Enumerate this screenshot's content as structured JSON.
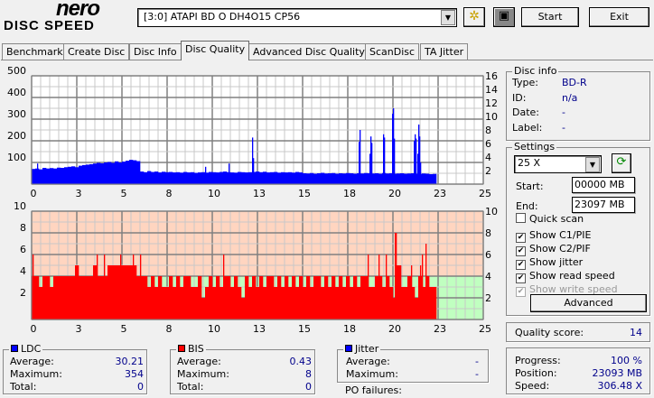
{
  "app": {
    "logo_top": "nero",
    "logo_bottom": "DISC SPEED"
  },
  "toolbar": {
    "drive": "[3:0]  ATAPI BD  O  DH4O15 CP56",
    "start_label": "Start",
    "exit_label": "Exit",
    "drive_icon": "drive-settings-icon",
    "save_icon": "floppy-disk-icon"
  },
  "tabs": [
    {
      "label": "Benchmark"
    },
    {
      "label": "Create Disc"
    },
    {
      "label": "Disc Info"
    },
    {
      "label": "Disc Quality",
      "selected": true
    },
    {
      "label": "Advanced Disc Quality"
    },
    {
      "label": "ScanDisc"
    },
    {
      "label": "TA Jitter"
    }
  ],
  "disc_info": {
    "title": "Disc info",
    "type_label": "Type:",
    "type": "BD-R",
    "id_label": "ID:",
    "id": "n/a",
    "date_label": "Date:",
    "date": "-",
    "label_label": "Label:",
    "label": "-"
  },
  "settings": {
    "title": "Settings",
    "speed": "25 X",
    "start_label": "Start:",
    "start": "00000 MB",
    "end_label": "End:",
    "end": "23097 MB",
    "checks": [
      {
        "label": "Quick scan",
        "checked": false,
        "enabled": true
      },
      {
        "label": "Show C1/PIE",
        "checked": true,
        "enabled": true
      },
      {
        "label": "Show C2/PIF",
        "checked": true,
        "enabled": true
      },
      {
        "label": "Show jitter",
        "checked": true,
        "enabled": true
      },
      {
        "label": "Show read speed",
        "checked": true,
        "enabled": true
      },
      {
        "label": "Show write speed",
        "checked": true,
        "enabled": false
      }
    ],
    "advanced_label": "Advanced"
  },
  "quality": {
    "label": "Quality score:",
    "value": "14"
  },
  "progress": {
    "progress_label": "Progress:",
    "progress": "100 %",
    "position_label": "Position:",
    "position": "23093 MB",
    "speed_label": "Speed:",
    "speed": "306.48 X"
  },
  "ldc": {
    "title": "LDC",
    "color": "#0000ff",
    "avg_label": "Average:",
    "avg": "30.21",
    "max_label": "Maximum:",
    "max": "354",
    "total_label": "Total:",
    "total": "0"
  },
  "bis": {
    "title": "BIS",
    "color": "#ff0000",
    "avg_label": "Average:",
    "avg": "0.43",
    "max_label": "Maximum:",
    "max": "8",
    "total_label": "Total:",
    "total": "0"
  },
  "jitter": {
    "title": "Jitter",
    "color": "#0000ff",
    "avg_label": "Average:",
    "avg": "-",
    "max_label": "Maximum:",
    "max": "-",
    "po_label": "PO failures:"
  },
  "chart_data": [
    {
      "type": "bar",
      "name": "LDC",
      "color": "#0000ff",
      "xlim": [
        0,
        25
      ],
      "ylim_left": [
        0,
        500
      ],
      "ylim_right": [
        0,
        16
      ],
      "x_ticks": [
        "0",
        "3",
        "5",
        "8",
        "10",
        "13",
        "15",
        "18",
        "20",
        "23",
        "25"
      ],
      "y_ticks_left": [
        "500",
        "400",
        "300",
        "200",
        "100"
      ],
      "y_ticks_right": [
        "16",
        "14",
        "12",
        "10",
        "8",
        "6",
        "4",
        "2"
      ],
      "step": 0.2,
      "values": [
        70,
        72,
        68,
        75,
        72,
        74,
        72,
        76,
        75,
        78,
        80,
        82,
        78,
        85,
        88,
        90,
        92,
        95,
        98,
        96,
        100,
        102,
        98,
        105,
        100,
        104,
        108,
        112,
        110,
        106,
        58,
        55,
        60,
        56,
        58,
        54,
        57,
        55,
        56,
        54,
        55,
        53,
        56,
        54,
        55,
        52,
        54,
        55,
        53,
        56,
        55,
        54,
        56,
        58,
        55,
        54,
        53,
        56,
        55,
        54,
        55,
        56,
        58,
        55,
        57,
        54,
        55,
        56,
        53,
        55,
        54,
        55,
        53,
        56,
        54,
        50,
        49,
        51,
        48,
        50,
        52,
        49,
        50,
        51,
        48,
        50,
        49,
        51,
        50,
        48,
        50,
        49,
        51,
        50,
        49,
        50,
        48,
        51,
        49,
        50,
        48,
        49,
        50,
        48,
        49,
        50,
        48,
        47,
        49,
        48,
        46,
        47
      ],
      "spikes": [
        [
          0.3,
          95
        ],
        [
          9.6,
          80
        ],
        [
          10.9,
          95
        ],
        [
          12.2,
          215
        ],
        [
          12.25,
          120
        ],
        [
          18.1,
          195
        ],
        [
          18.15,
          250
        ],
        [
          18.7,
          140
        ],
        [
          18.75,
          220
        ],
        [
          18.8,
          190
        ],
        [
          19.45,
          230
        ],
        [
          19.5,
          215
        ],
        [
          19.95,
          325
        ],
        [
          20.0,
          350
        ],
        [
          20.05,
          210
        ],
        [
          21.15,
          200
        ],
        [
          21.2,
          230
        ],
        [
          21.25,
          210
        ],
        [
          21.35,
          140
        ],
        [
          21.4,
          275
        ],
        [
          21.45,
          220
        ],
        [
          21.5,
          100
        ]
      ]
    },
    {
      "type": "bar",
      "name": "BIS",
      "color": "#ff0000",
      "xlim": [
        0,
        25
      ],
      "ylim": [
        0,
        10
      ],
      "threshold": 4,
      "bg_above": "#ffd5c0",
      "bg_below": "#c0ffc0",
      "x_ticks": [
        "0",
        "3",
        "5",
        "8",
        "10",
        "13",
        "15",
        "18",
        "20",
        "23",
        "25"
      ],
      "y_ticks": [
        "10",
        "8",
        "6",
        "4",
        "2"
      ],
      "step": 0.2,
      "values": [
        4,
        4,
        3,
        4,
        4,
        3,
        4,
        4,
        4,
        4,
        4,
        4,
        5,
        4,
        4,
        4,
        4,
        5,
        4,
        4,
        4,
        5,
        5,
        5,
        5,
        5,
        5,
        5,
        5,
        4,
        4,
        4,
        3,
        4,
        3,
        4,
        3,
        3,
        4,
        3,
        4,
        3,
        4,
        4,
        3,
        3,
        4,
        2,
        3,
        4,
        3,
        4,
        3,
        4,
        4,
        3,
        4,
        3,
        2,
        4,
        3,
        4,
        3,
        4,
        3,
        4,
        4,
        3,
        4,
        3,
        4,
        3,
        4,
        3,
        4,
        3,
        4,
        3,
        4,
        4,
        3,
        4,
        3,
        4,
        3,
        4,
        3,
        4,
        3,
        4,
        3,
        4,
        4,
        3,
        3,
        4,
        4,
        3,
        4,
        3,
        2,
        5,
        3,
        3,
        4,
        3,
        2,
        4,
        3,
        4,
        3,
        3
      ],
      "spikes": [
        [
          0.05,
          6
        ],
        [
          3.6,
          6
        ],
        [
          4.0,
          6
        ],
        [
          4.9,
          6
        ],
        [
          5.6,
          6
        ],
        [
          6.0,
          6
        ],
        [
          10.6,
          6
        ],
        [
          18.6,
          6
        ],
        [
          19.2,
          6
        ],
        [
          19.6,
          6
        ],
        [
          20.1,
          8
        ],
        [
          20.15,
          8
        ],
        [
          20.4,
          5
        ],
        [
          21.0,
          5
        ],
        [
          21.5,
          5
        ],
        [
          21.6,
          6
        ],
        [
          21.8,
          7
        ]
      ]
    }
  ]
}
